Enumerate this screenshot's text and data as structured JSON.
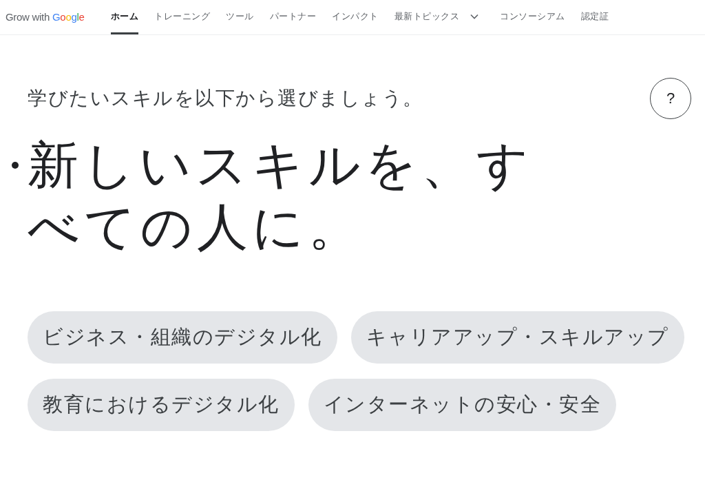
{
  "header": {
    "logo": {
      "prefix": "Grow with",
      "brand": "Google"
    },
    "nav": [
      {
        "label": "ホーム",
        "kind": "link",
        "selected": true
      },
      {
        "label": "トレーニング",
        "kind": "link",
        "selected": false
      },
      {
        "label": "ツール",
        "kind": "link",
        "selected": false
      },
      {
        "label": "パートナー",
        "kind": "link",
        "selected": false
      },
      {
        "label": "インパクト",
        "kind": "link",
        "selected": false
      },
      {
        "label": "最新トピックス",
        "kind": "dropdown",
        "selected": false
      },
      {
        "label": "コンソーシアム",
        "kind": "link",
        "selected": false
      },
      {
        "label": "認定証",
        "kind": "link",
        "selected": false
      }
    ]
  },
  "intro": {
    "prompt": "学びたいスキルを以下から選びましょう。",
    "help_button": "?"
  },
  "headline": "新しいスキルを、すべての人に。",
  "topics": [
    "ビジネス・組織のデジタル化",
    "キャリアアップ・スキルアップ",
    "教育におけるデジタル化",
    "インターネットの安心・安全"
  ]
}
